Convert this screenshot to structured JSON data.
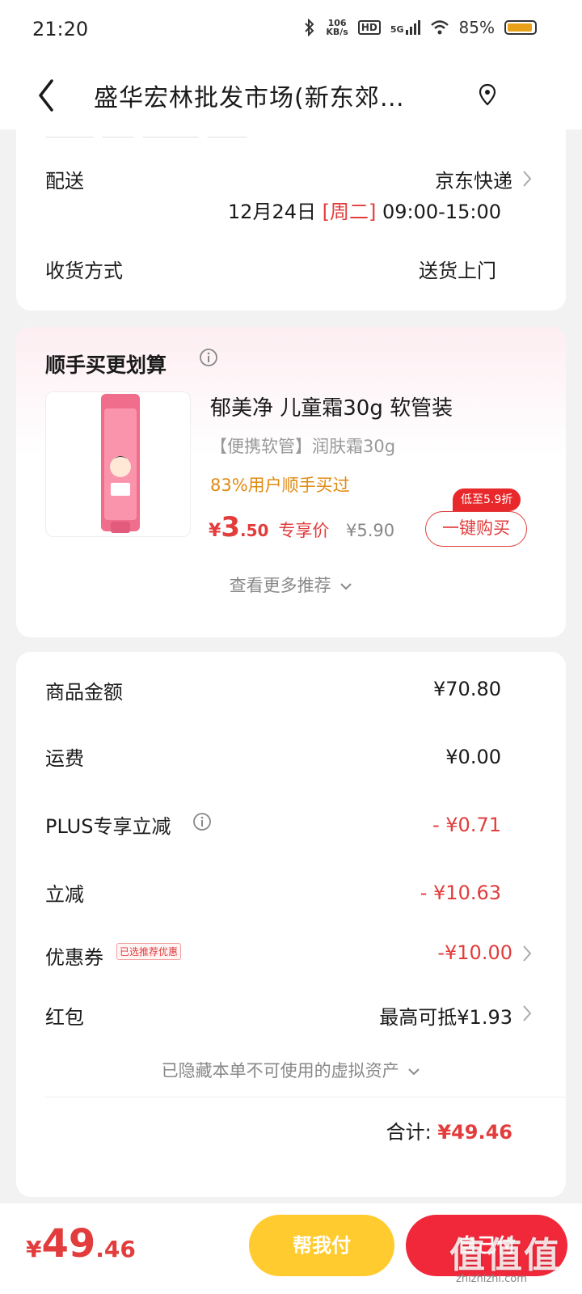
{
  "status_bar": {
    "time": "21:20",
    "speed_value": "106",
    "speed_unit": "KB/s",
    "hd": "HD",
    "network": "5G",
    "battery": "85%"
  },
  "nav": {
    "title": "盛华宏林批发市场(新东郊…"
  },
  "delivery": {
    "label": "配送",
    "carrier": "京东快递",
    "date": "12月24日",
    "weekday": "[周二]",
    "time_window": "09:00-15:00"
  },
  "receive": {
    "label": "收货方式",
    "value": "送货上门"
  },
  "recommend": {
    "title": "顺手买更划算",
    "product": {
      "name": "郁美净 儿童霜30g 软管装",
      "subtitle": "【便携软管】润肤霜30g",
      "rate": "83%用户顺手买过",
      "price_symbol": "¥",
      "price_int": "3",
      "price_dec": ".50",
      "price_tag": "专享价",
      "original_price": "¥5.90",
      "discount": "低至5.9折",
      "buy_label": "一键购买"
    },
    "more_label": "查看更多推荐"
  },
  "summary": {
    "rows": [
      {
        "label": "商品金额",
        "value": "¥70.80"
      },
      {
        "label": "运费",
        "value": "¥0.00"
      },
      {
        "label": "PLUS专享立减",
        "value": "- ¥0.71"
      },
      {
        "label": "立减",
        "value": "- ¥10.63"
      },
      {
        "label": "优惠券",
        "value": "-¥10.00"
      },
      {
        "label": "红包",
        "value": "最高可抵¥1.93"
      }
    ],
    "coupon_badge": "已选推荐优惠",
    "hidden_assets": "已隐藏本单不可使用的虚拟资产",
    "total_label": "合计:",
    "total_value": "¥49.46"
  },
  "bottom": {
    "price_symbol": "¥",
    "price_int": "49",
    "price_dec": ".46",
    "help_pay": "帮我付",
    "pay_self": "自己付"
  },
  "watermark": {
    "main": "值值值",
    "sub": "zhizhizhi.com"
  },
  "colors": {
    "accent_red": "#e23c3c",
    "pay_yellow": "#ffcb2e",
    "pay_red": "#f0283a",
    "rate_orange": "#e08a12"
  }
}
